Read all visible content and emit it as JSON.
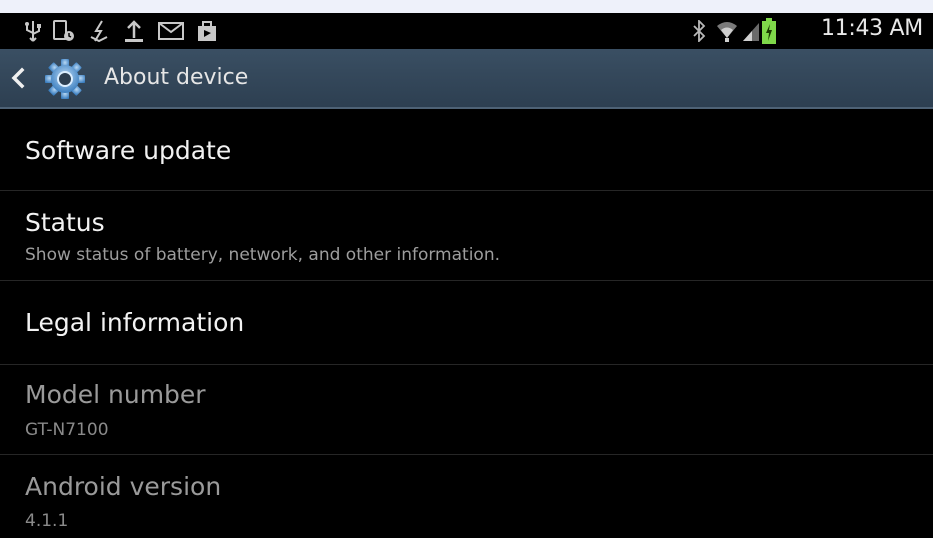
{
  "status_bar": {
    "time": "11:43 AM",
    "left_icons": [
      "usb-icon",
      "phone-recording-icon",
      "download-icon",
      "upload-icon",
      "email-icon",
      "store-icon"
    ],
    "right_icons": [
      "bluetooth-icon",
      "wifi-icon",
      "signal-icon",
      "battery-icon"
    ]
  },
  "action_bar": {
    "title": "About device",
    "icon": "gear-icon",
    "back_icon": "chevron-left-icon",
    "accent": "#2d3f51"
  },
  "items": [
    {
      "title": "Software update",
      "summary": ""
    },
    {
      "title": "Status",
      "summary": "Show status of battery, network, and other information."
    },
    {
      "title": "Legal information",
      "summary": ""
    },
    {
      "title": "Model number",
      "summary": "GT-N7100"
    },
    {
      "title": "Android version",
      "summary": "4.1.1"
    }
  ]
}
